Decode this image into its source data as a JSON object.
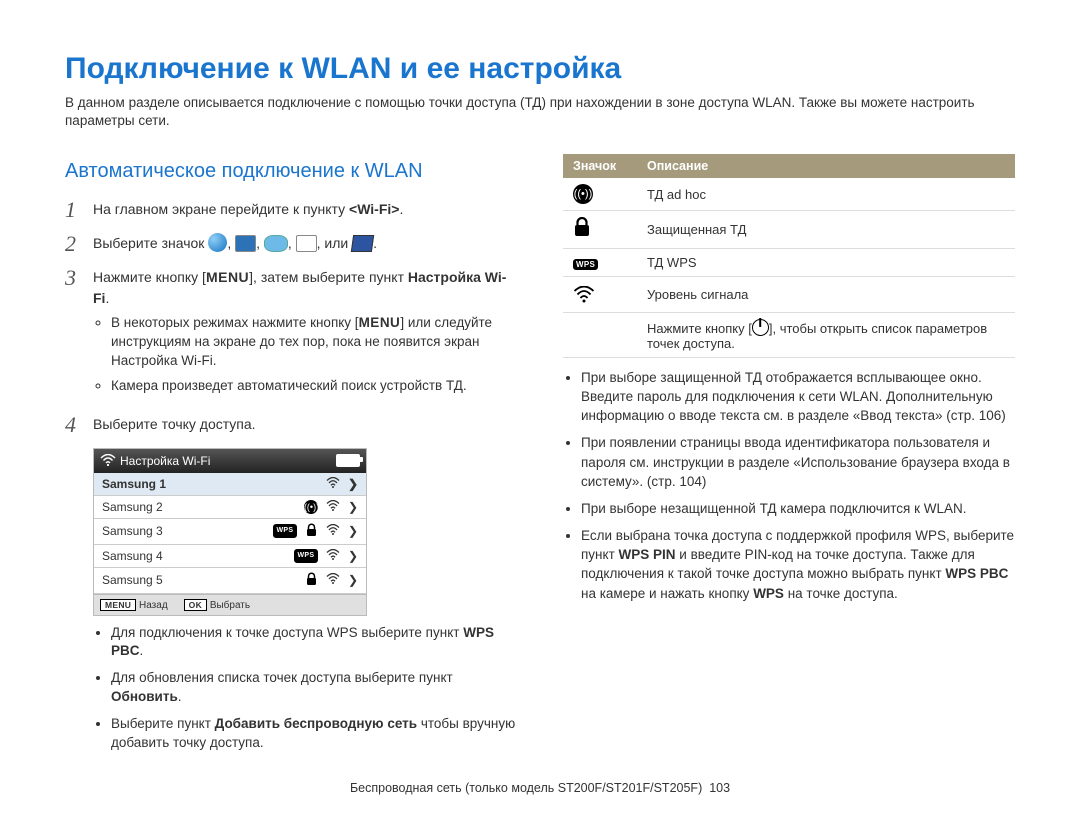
{
  "page": {
    "title": "Подключение к WLAN и ее настройка",
    "intro": "В данном разделе описывается подключение с помощью точки доступа (ТД) при нахождении в зоне доступа WLAN. Также вы можете настроить параметры сети."
  },
  "section": {
    "title": "Автоматическое подключение к WLAN"
  },
  "steps": {
    "s1_pre": "На главном экране перейдите к пункту ",
    "s1_bold": "<Wi-Fi>",
    "s1_post": ".",
    "s2_pre": "Выберите значок ",
    "s2_post": ", или ",
    "s2_end": ".",
    "s3_pre": "Нажмите кнопку [",
    "s3_menu": "MENU",
    "s3_mid": "], затем выберите пункт ",
    "s3_bold": "Настройка Wi-Fi",
    "s3_post": ".",
    "s3_sub1_pre": "В некоторых режимах нажмите кнопку [",
    "s3_sub1_menu": "MENU",
    "s3_sub1_post": "] или следуйте инструкциям на экране до тех пор, пока не появится экран Настройка Wi-Fi.",
    "s3_sub2": "Камера произведет автоматический поиск устройств ТД.",
    "s4": "Выберите точку доступа."
  },
  "device": {
    "header": "Настройка Wi-Fi",
    "rows": [
      {
        "name": "Samsung 1",
        "icon_kind": "none"
      },
      {
        "name": "Samsung 2",
        "icon_kind": "adhoc"
      },
      {
        "name": "Samsung 3",
        "icon_kind": "wps_lock"
      },
      {
        "name": "Samsung 4",
        "icon_kind": "wps"
      },
      {
        "name": "Samsung 5",
        "icon_kind": "lock"
      }
    ],
    "footer": {
      "menu_key": "MENU",
      "menu_label": "Назад",
      "ok_key": "OK",
      "ok_label": "Выбрать"
    }
  },
  "after_device": [
    {
      "pre": "Для подключения к точке доступа WPS выберите пункт ",
      "bold": "WPS PBC",
      "post": "."
    },
    {
      "pre": "Для обновления списка точек доступа выберите пункт ",
      "bold": "Обновить",
      "post": "."
    },
    {
      "pre": "Выберите пункт  ",
      "bold": "Добавить беспроводную сеть",
      "post": " чтобы вручную добавить точку доступа."
    }
  ],
  "table": {
    "h1": "Значок",
    "h2": "Описание",
    "rows": {
      "adhoc": "ТД ad hoc",
      "lock": "Защищенная ТД",
      "wps": "ТД WPS",
      "signal": "Уровень сигнала",
      "power_pre": "Нажмите кнопку [",
      "power_post": "], чтобы открыть список параметров точек доступа."
    }
  },
  "right_bullets": [
    "При выборе защищенной ТД отображается всплывающее окно. Введите пароль для подключения к сети WLAN. Дополнительную информацию о вводе текста см. в разделе «Ввод текста» (стр. 106)",
    "При появлении страницы ввода идентификатора пользователя и пароля см. инструкции в разделе «Использование браузера входа в систему». (стр. 104)",
    "При выборе незащищенной ТД камера подключится к WLAN."
  ],
  "wps_bullet": {
    "pre": "Если выбрана точка доступа с поддержкой профиля WPS, выберите пункт ",
    "b1": "WPS PIN",
    "mid1": " и введите PIN-код на точке доступа. Также для подключения к такой точке доступа можно выбрать пункт ",
    "b2": "WPS PBC",
    "mid2": " на камере и нажать кнопку ",
    "b3": "WPS",
    "post": " на точке доступа."
  },
  "footer": {
    "text": "Беспроводная сеть  (только модель ST200F/ST201F/ST205F)",
    "page_no": "103"
  }
}
